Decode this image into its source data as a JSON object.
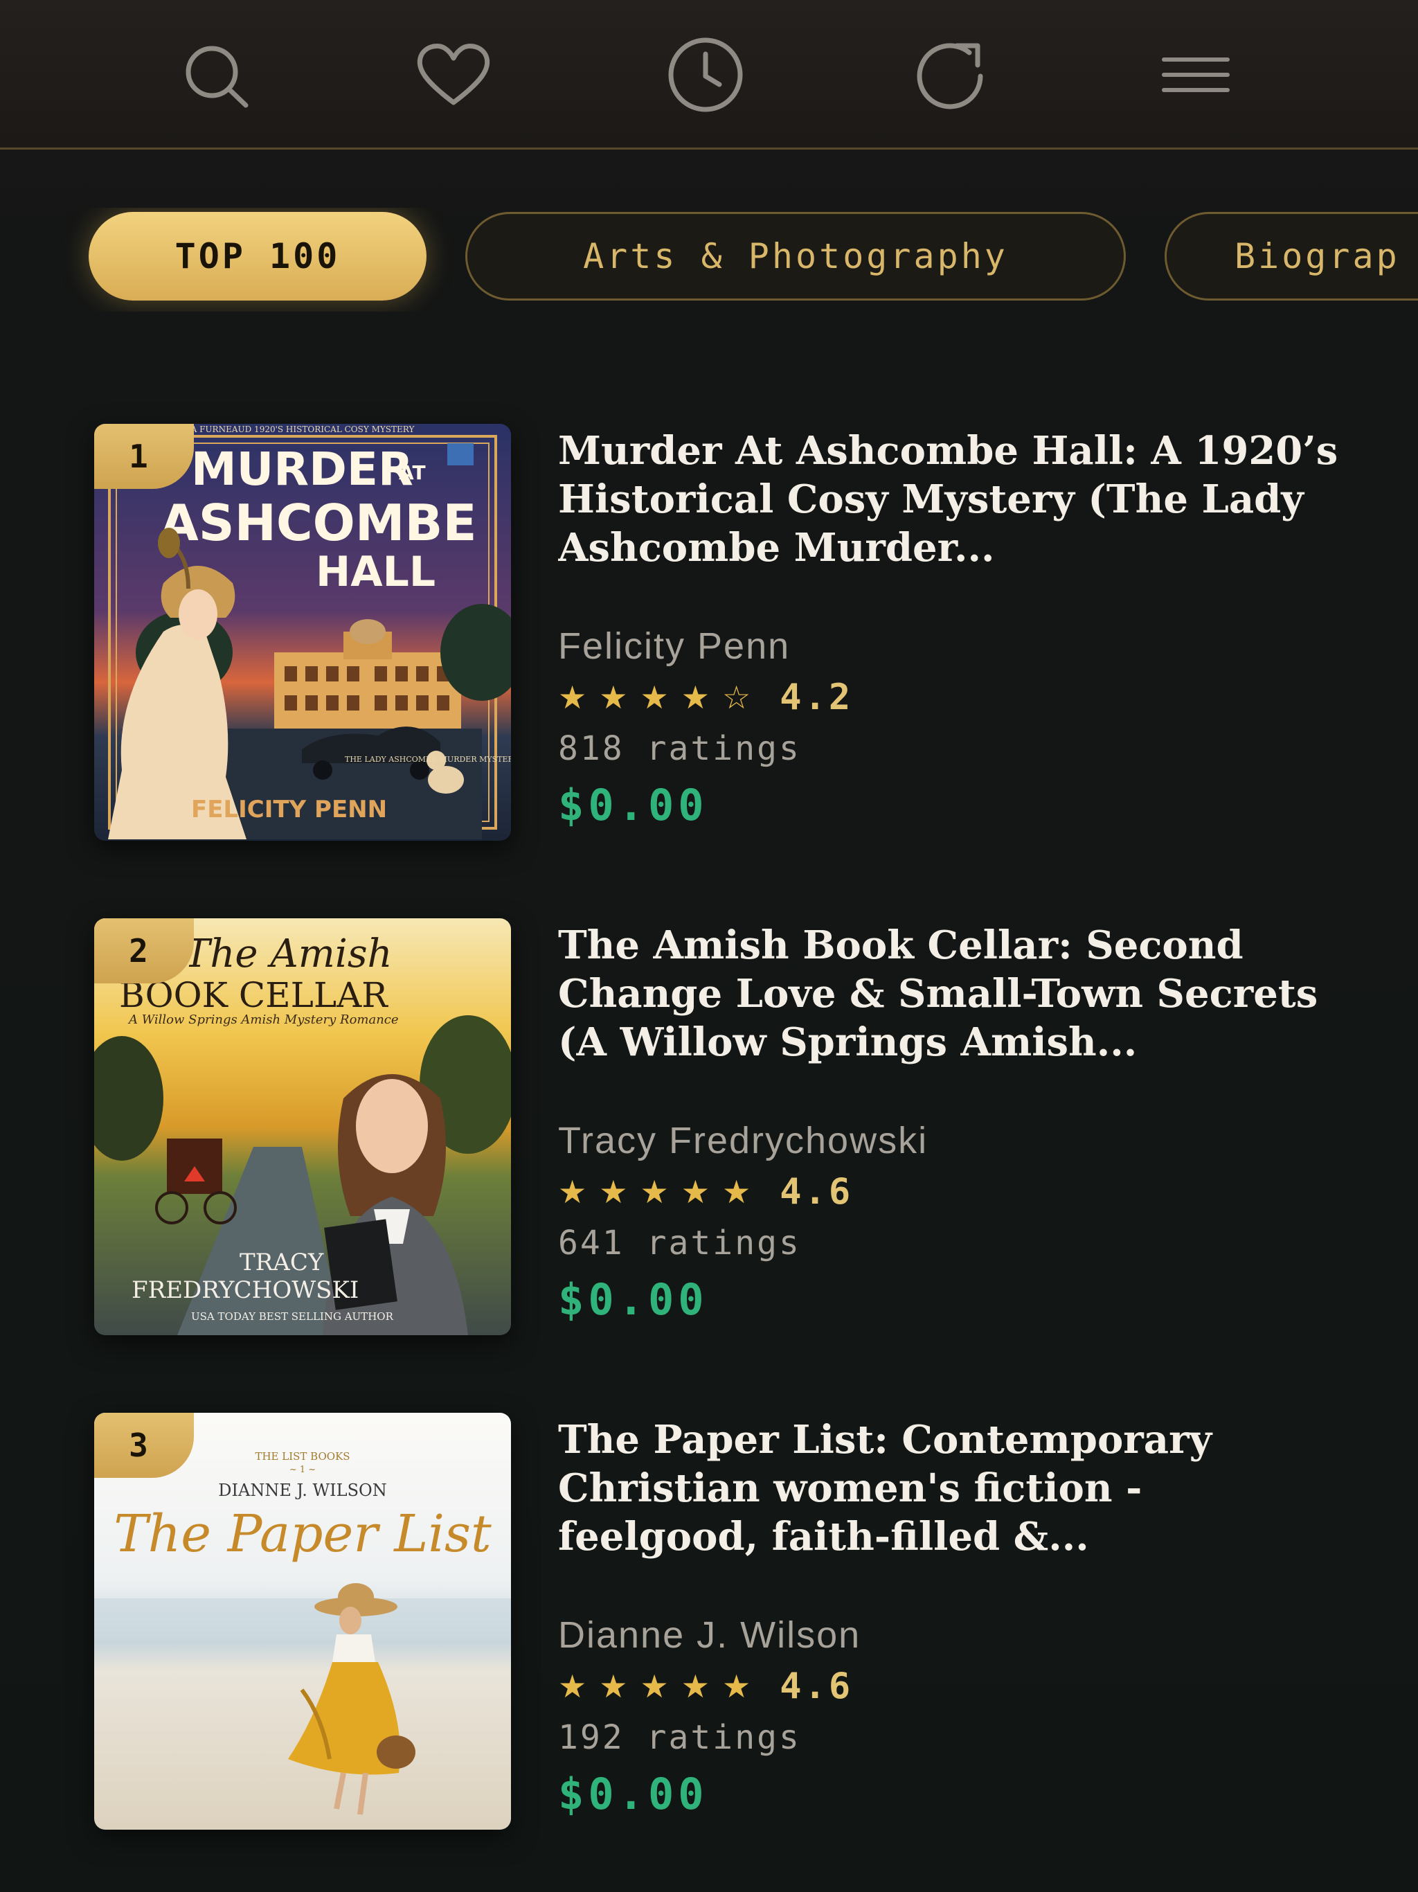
{
  "nav": {
    "icons": [
      "search-icon",
      "heart-icon",
      "clock-icon",
      "refresh-icon",
      "menu-icon"
    ]
  },
  "categories": [
    {
      "label": "TOP 100",
      "active": true
    },
    {
      "label": "Arts & Photography",
      "active": false
    },
    {
      "label": "Biograp",
      "active": false
    }
  ],
  "books": [
    {
      "rank": "1",
      "title": "Murder At Ashcombe Hall: A 1920’s Historical Cosy Mystery (The Lady Ashcombe Murder...",
      "author": "Felicity Penn",
      "stars": "★★★★☆",
      "rating": "4.2",
      "ratings_count": "818 ratings",
      "price": "$0.00",
      "cover": {
        "top_text": "A FURNEAUD 1920'S HISTORICAL COSY MYSTERY",
        "title_line1": "MURDER",
        "title_at": "AT",
        "title_line2": "ASHCOMBE",
        "title_line3": "HALL",
        "series": "THE LADY ASHCOMBE MURDER MYSTERIES",
        "author": "FELICITY PENN"
      }
    },
    {
      "rank": "2",
      "title": "The Amish Book Cellar: Second Change Love & Small-Town Secrets (A Willow Springs Amish...",
      "author": "Tracy Fredrychowski",
      "stars": "★★★★★",
      "rating": "4.6",
      "ratings_count": "641 ratings",
      "price": "$0.00",
      "cover": {
        "script_title": "The Amish",
        "title": "BOOK CELLAR",
        "subtitle": "A Willow Springs Amish Mystery Romance",
        "author_line1": "TRACY",
        "author_line2": "FREDRYCHOWSKI",
        "tagline": "USA TODAY BEST SELLING AUTHOR"
      }
    },
    {
      "rank": "3",
      "title": "The Paper List: Contemporary Christian women's fiction - feelgood, faith-filled &...",
      "author": "Dianne J. Wilson",
      "stars": "★★★★★",
      "rating": "4.6",
      "ratings_count": "192 ratings",
      "price": "$0.00",
      "cover": {
        "series": "THE LIST BOOKS",
        "series_no": "~ 1 ~",
        "author": "DIANNE J. WILSON",
        "title": "The Paper List"
      }
    }
  ],
  "colors": {
    "accent_gold": "#d9ad55",
    "price_green": "#2fb37a",
    "star_gold": "#e6b94b"
  }
}
